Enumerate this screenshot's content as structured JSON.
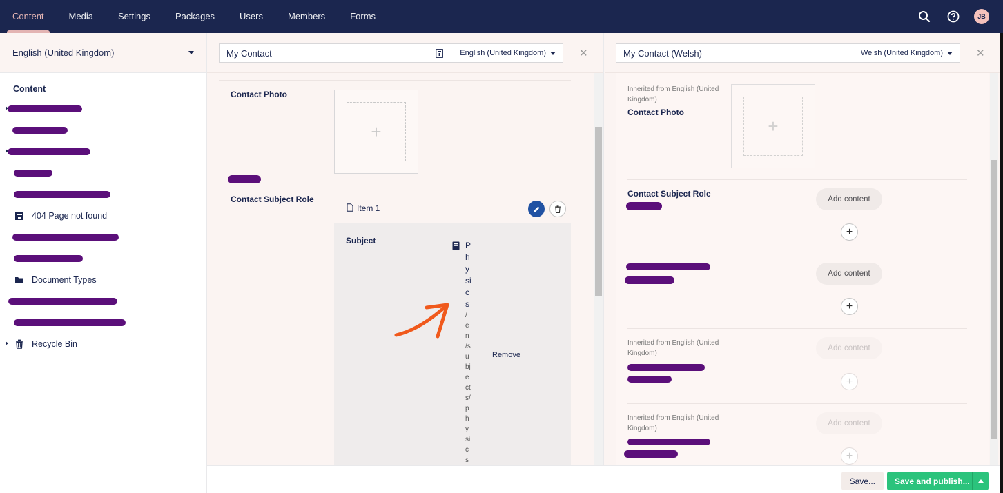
{
  "nav": {
    "tabs": [
      "Content",
      "Media",
      "Settings",
      "Packages",
      "Users",
      "Members",
      "Forms"
    ],
    "active": "Content",
    "user_initials": "JB"
  },
  "tree": {
    "language": "English (United Kingdom)",
    "root": "Content",
    "items": {
      "p404": "404 Page not found",
      "doctypes": "Document Types",
      "recycle": "Recycle Bin"
    }
  },
  "left_pane": {
    "name": "My Contact",
    "language": "English (United Kingdom)",
    "photo_label": "Contact Photo",
    "subject_role_label": "Contact Subject Role",
    "block_item_title": "Item 1",
    "subject_label": "Subject",
    "subject_value_chars": [
      "P",
      "h",
      "y",
      "si",
      "c",
      "s",
      "/",
      "e",
      "n",
      "/s",
      "u",
      "bj",
      "e",
      "ct",
      "s/",
      "p",
      "h",
      "y",
      "si",
      "c",
      "s"
    ],
    "remove_label": "Remove"
  },
  "right_pane": {
    "name": "My Contact (Welsh)",
    "language": "Welsh (United Kingdom)",
    "inherited_text": "Inherited from English (United Kingdom)",
    "photo_label": "Contact Photo",
    "subject_role_label": "Contact Subject Role",
    "add_content_label": "Add content"
  },
  "footer": {
    "save_label": "Save...",
    "publish_label": "Save and publish..."
  },
  "colors": {
    "nav_bg": "#1b264f",
    "accent": "#f5c1bc",
    "publish": "#2bc37c",
    "edit_button": "#2152a3",
    "redaction": "#5b0f7a",
    "annotation_arrow": "#f0591c"
  }
}
